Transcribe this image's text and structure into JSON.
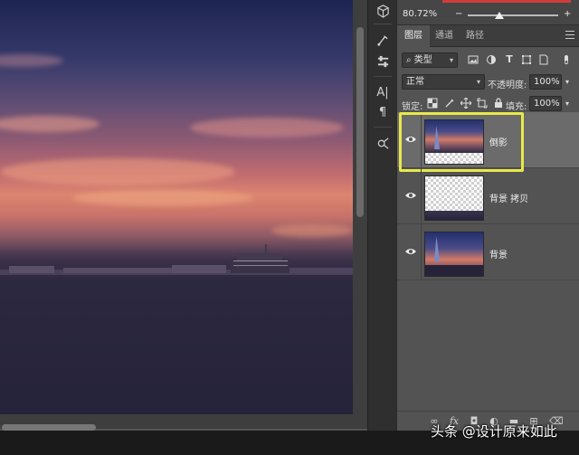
{
  "properties": {
    "zoom": "80.72%"
  },
  "tabs": [
    {
      "label": "图层",
      "active": true
    },
    {
      "label": "通道",
      "active": false
    },
    {
      "label": "路径",
      "active": false
    }
  ],
  "filter": {
    "kind": "类型"
  },
  "blend": {
    "mode": "正常",
    "opacity_label": "不透明度:",
    "opacity": "100%"
  },
  "lock": {
    "label": "锁定:",
    "fill_label": "填充:",
    "fill": "100%"
  },
  "layers": [
    {
      "name": "倒影",
      "selected": true
    },
    {
      "name": "背景 拷贝",
      "selected": false
    },
    {
      "name": "背景",
      "selected": false
    }
  ],
  "toolbar": {
    "type_tool": "A|",
    "paragraph_tool": "¶"
  },
  "watermark": "头条 @设计原来如此",
  "colors": {
    "highlight": "#e8e84a",
    "zoom_bar": "#d23b3b"
  }
}
